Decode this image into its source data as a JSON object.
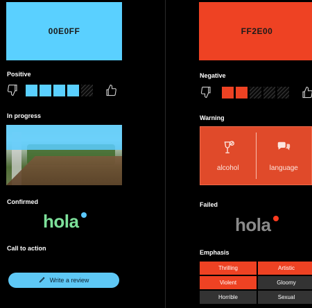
{
  "left": {
    "swatch_hex": "00E0FF",
    "swatch_color": "#5ad0ff",
    "positive_label": "Positive",
    "positive_rating": {
      "filled": 4,
      "total": 5
    },
    "progress_label": "In progress",
    "confirmed_label": "Confirmed",
    "logo_text": "hola",
    "logo_color": "#7de09a",
    "dot_color": "#5ac8ff",
    "cta_label": "Call to action",
    "cta_button": "Write a review",
    "accent": "#5ac8ff"
  },
  "right": {
    "swatch_hex": "FF2E00",
    "swatch_color": "#ee4223",
    "negative_label": "Negative",
    "negative_rating": {
      "filled": 2,
      "total": 5
    },
    "warning_label": "Warning",
    "warning_items": [
      {
        "icon": "wine-glass-icon",
        "label": "alcohol"
      },
      {
        "icon": "speech-bubble-icon",
        "label": "language"
      }
    ],
    "failed_label": "Failed",
    "logo_text": "hola",
    "logo_color": "#8a8a8a",
    "dot_color": "#ff3b1f",
    "emphasis_label": "Emphasis",
    "emphasis_chips": [
      {
        "label": "Thrilling",
        "active": true
      },
      {
        "label": "Artistic",
        "active": true
      },
      {
        "label": "Violent",
        "active": true
      },
      {
        "label": "Gloomy",
        "active": false
      },
      {
        "label": "Horrible",
        "active": false
      },
      {
        "label": "Sexual",
        "active": false
      }
    ]
  }
}
